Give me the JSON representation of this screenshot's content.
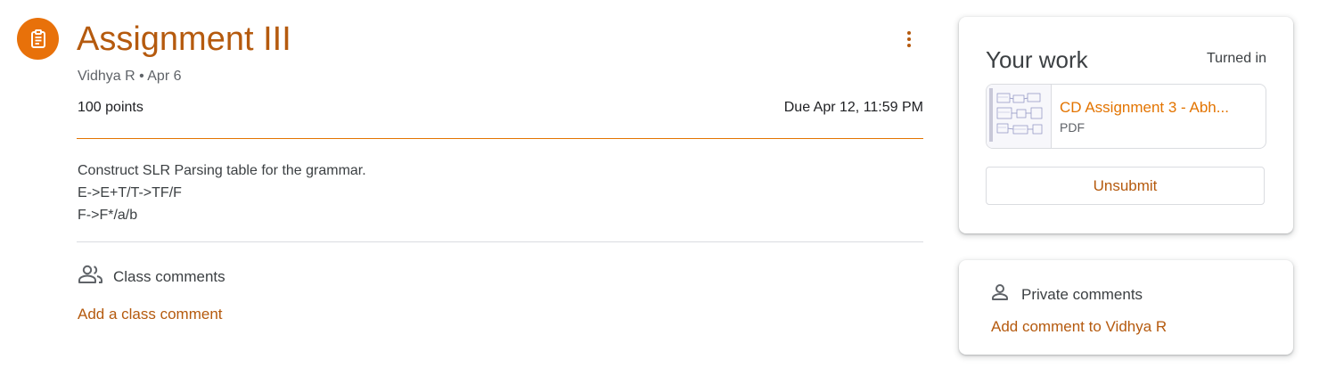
{
  "colors": {
    "accent": "#e8710a",
    "accent_text": "#b55a0e",
    "link": "#e37400",
    "divider": "#dadce0"
  },
  "assignment": {
    "icon": "assignment-icon",
    "title": "Assignment III",
    "meta": "Vidhya R • Apr 6",
    "points": "100 points",
    "due": "Due Apr 12, 11:59 PM",
    "more_icon": "more-vert-icon",
    "description": [
      "Construct SLR Parsing table for the grammar.",
      "E->E+T/T->TF/F",
      "F->F*/a/b"
    ]
  },
  "class_comments": {
    "icon": "people-icon",
    "label": "Class comments",
    "add_label": "Add a class comment"
  },
  "your_work": {
    "title": "Your work",
    "status": "Turned in",
    "attachment": {
      "name": "CD Assignment 3 - Abh...",
      "type": "PDF"
    },
    "unsubmit_label": "Unsubmit"
  },
  "private_comments": {
    "icon": "person-icon",
    "label": "Private comments",
    "add_label": "Add comment to Vidhya R"
  }
}
